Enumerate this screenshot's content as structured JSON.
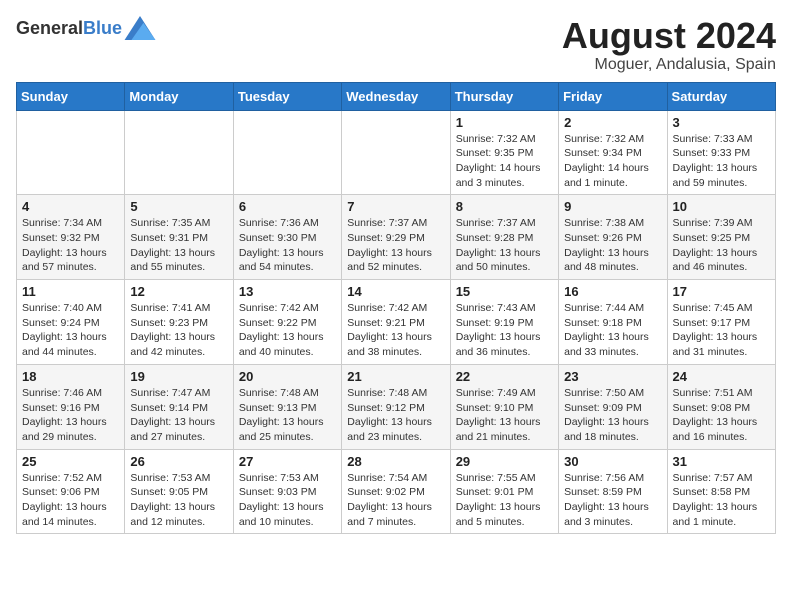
{
  "header": {
    "logo_general": "General",
    "logo_blue": "Blue",
    "month_title": "August 2024",
    "location": "Moguer, Andalusia, Spain"
  },
  "days_of_week": [
    "Sunday",
    "Monday",
    "Tuesday",
    "Wednesday",
    "Thursday",
    "Friday",
    "Saturday"
  ],
  "weeks": [
    [
      {
        "day": "",
        "info": ""
      },
      {
        "day": "",
        "info": ""
      },
      {
        "day": "",
        "info": ""
      },
      {
        "day": "",
        "info": ""
      },
      {
        "day": "1",
        "info": "Sunrise: 7:32 AM\nSunset: 9:35 PM\nDaylight: 14 hours\nand 3 minutes."
      },
      {
        "day": "2",
        "info": "Sunrise: 7:32 AM\nSunset: 9:34 PM\nDaylight: 14 hours\nand 1 minute."
      },
      {
        "day": "3",
        "info": "Sunrise: 7:33 AM\nSunset: 9:33 PM\nDaylight: 13 hours\nand 59 minutes."
      }
    ],
    [
      {
        "day": "4",
        "info": "Sunrise: 7:34 AM\nSunset: 9:32 PM\nDaylight: 13 hours\nand 57 minutes."
      },
      {
        "day": "5",
        "info": "Sunrise: 7:35 AM\nSunset: 9:31 PM\nDaylight: 13 hours\nand 55 minutes."
      },
      {
        "day": "6",
        "info": "Sunrise: 7:36 AM\nSunset: 9:30 PM\nDaylight: 13 hours\nand 54 minutes."
      },
      {
        "day": "7",
        "info": "Sunrise: 7:37 AM\nSunset: 9:29 PM\nDaylight: 13 hours\nand 52 minutes."
      },
      {
        "day": "8",
        "info": "Sunrise: 7:37 AM\nSunset: 9:28 PM\nDaylight: 13 hours\nand 50 minutes."
      },
      {
        "day": "9",
        "info": "Sunrise: 7:38 AM\nSunset: 9:26 PM\nDaylight: 13 hours\nand 48 minutes."
      },
      {
        "day": "10",
        "info": "Sunrise: 7:39 AM\nSunset: 9:25 PM\nDaylight: 13 hours\nand 46 minutes."
      }
    ],
    [
      {
        "day": "11",
        "info": "Sunrise: 7:40 AM\nSunset: 9:24 PM\nDaylight: 13 hours\nand 44 minutes."
      },
      {
        "day": "12",
        "info": "Sunrise: 7:41 AM\nSunset: 9:23 PM\nDaylight: 13 hours\nand 42 minutes."
      },
      {
        "day": "13",
        "info": "Sunrise: 7:42 AM\nSunset: 9:22 PM\nDaylight: 13 hours\nand 40 minutes."
      },
      {
        "day": "14",
        "info": "Sunrise: 7:42 AM\nSunset: 9:21 PM\nDaylight: 13 hours\nand 38 minutes."
      },
      {
        "day": "15",
        "info": "Sunrise: 7:43 AM\nSunset: 9:19 PM\nDaylight: 13 hours\nand 36 minutes."
      },
      {
        "day": "16",
        "info": "Sunrise: 7:44 AM\nSunset: 9:18 PM\nDaylight: 13 hours\nand 33 minutes."
      },
      {
        "day": "17",
        "info": "Sunrise: 7:45 AM\nSunset: 9:17 PM\nDaylight: 13 hours\nand 31 minutes."
      }
    ],
    [
      {
        "day": "18",
        "info": "Sunrise: 7:46 AM\nSunset: 9:16 PM\nDaylight: 13 hours\nand 29 minutes."
      },
      {
        "day": "19",
        "info": "Sunrise: 7:47 AM\nSunset: 9:14 PM\nDaylight: 13 hours\nand 27 minutes."
      },
      {
        "day": "20",
        "info": "Sunrise: 7:48 AM\nSunset: 9:13 PM\nDaylight: 13 hours\nand 25 minutes."
      },
      {
        "day": "21",
        "info": "Sunrise: 7:48 AM\nSunset: 9:12 PM\nDaylight: 13 hours\nand 23 minutes."
      },
      {
        "day": "22",
        "info": "Sunrise: 7:49 AM\nSunset: 9:10 PM\nDaylight: 13 hours\nand 21 minutes."
      },
      {
        "day": "23",
        "info": "Sunrise: 7:50 AM\nSunset: 9:09 PM\nDaylight: 13 hours\nand 18 minutes."
      },
      {
        "day": "24",
        "info": "Sunrise: 7:51 AM\nSunset: 9:08 PM\nDaylight: 13 hours\nand 16 minutes."
      }
    ],
    [
      {
        "day": "25",
        "info": "Sunrise: 7:52 AM\nSunset: 9:06 PM\nDaylight: 13 hours\nand 14 minutes."
      },
      {
        "day": "26",
        "info": "Sunrise: 7:53 AM\nSunset: 9:05 PM\nDaylight: 13 hours\nand 12 minutes."
      },
      {
        "day": "27",
        "info": "Sunrise: 7:53 AM\nSunset: 9:03 PM\nDaylight: 13 hours\nand 10 minutes."
      },
      {
        "day": "28",
        "info": "Sunrise: 7:54 AM\nSunset: 9:02 PM\nDaylight: 13 hours\nand 7 minutes."
      },
      {
        "day": "29",
        "info": "Sunrise: 7:55 AM\nSunset: 9:01 PM\nDaylight: 13 hours\nand 5 minutes."
      },
      {
        "day": "30",
        "info": "Sunrise: 7:56 AM\nSunset: 8:59 PM\nDaylight: 13 hours\nand 3 minutes."
      },
      {
        "day": "31",
        "info": "Sunrise: 7:57 AM\nSunset: 8:58 PM\nDaylight: 13 hours\nand 1 minute."
      }
    ]
  ]
}
